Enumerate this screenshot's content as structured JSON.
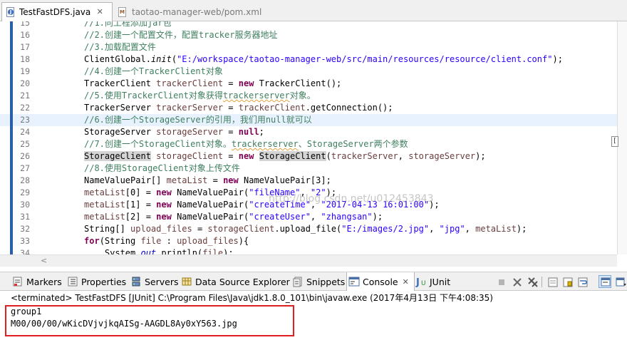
{
  "editor_tabs": [
    {
      "label": "TestFastDFS.java",
      "icon": "java-file-icon",
      "active": true,
      "close": "✕"
    },
    {
      "label": "taotao-manager-web/pom.xml",
      "icon": "xml-file-icon",
      "active": false
    }
  ],
  "code_lines": [
    {
      "n": "15",
      "html": "<span class=\"cmt\">//1.向工程添加jar包</span>"
    },
    {
      "n": "16",
      "html": "<span class=\"cmt\">//2.创建一个配置文件，配置tracker服务器地址</span>"
    },
    {
      "n": "17",
      "html": "<span class=\"cmt\">//3.加载配置文件</span>"
    },
    {
      "n": "18",
      "html": "ClientGlobal.<span class=\"ital\">init</span>(<span class=\"str\">\"E:/workspace/taotao-manager-web/src/main/resources/resource/client.conf\"</span>);"
    },
    {
      "n": "19",
      "html": "<span class=\"cmt\">//4.创建一个TrackerClient对象</span>"
    },
    {
      "n": "20",
      "html": "TrackerClient <span class=\"var\">trackerClient</span> = <span class=\"kw\">new</span> TrackerClient();"
    },
    {
      "n": "21",
      "html": "<span class=\"cmt\">//5.使用TrackerClient对象获得<span class=\"squig\">trackerserver</span>对象。</span>"
    },
    {
      "n": "22",
      "html": "TrackerServer <span class=\"var\">trackerServer</span> = <span class=\"var\">trackerClient</span>.getConnection();"
    },
    {
      "n": "23",
      "html": "<span class=\"cmt\">//6.创建一个StorageServer的引用，我们用null就可以</span>",
      "current": true
    },
    {
      "n": "24",
      "html": "StorageServer <span class=\"var\">storageServer</span> = <span class=\"kw\">null</span>;"
    },
    {
      "n": "25",
      "html": "<span class=\"cmt\">//7.创建一个StorageClient对象。<span class=\"squig\">trackerserver</span>、StorageServer两个参数</span>"
    },
    {
      "n": "26",
      "html": "<span class=\"hl\">StorageClient</span> <span class=\"var\">storageClient</span> = <span class=\"kw\">new</span> <span class=\"hl\">StorageClient</span>(<span class=\"var\">trackerServer</span>, <span class=\"var\">storageServer</span>);"
    },
    {
      "n": "27",
      "html": "<span class=\"cmt\">//8.使用StorageClient对象上传文件</span>"
    },
    {
      "n": "28",
      "html": "NameValuePair[] <span class=\"var\">metaList</span> = <span class=\"kw\">new</span> NameValuePair[3];"
    },
    {
      "n": "29",
      "html": "<span class=\"var\">metaList</span>[0] = <span class=\"kw\">new</span> NameValuePair(<span class=\"str\">\"fileName\"</span>, <span class=\"str\">\"2\"</span>);"
    },
    {
      "n": "30",
      "html": "<span class=\"var\">metaList</span>[1] = <span class=\"kw\">new</span> NameValuePair(<span class=\"str\">\"createTime\"</span>, <span class=\"str\">\"2017-04-13 16:01:00\"</span>);"
    },
    {
      "n": "31",
      "html": "<span class=\"var\">metaList</span>[2] = <span class=\"kw\">new</span> NameValuePair(<span class=\"str\">\"createUser\"</span>, <span class=\"str\">\"zhangsan\"</span>);"
    },
    {
      "n": "32",
      "html": "String[] <span class=\"var\">upload_files</span> = <span class=\"var\">storageClient</span>.upload_file(<span class=\"str\">\"E:/images/2.jpg\"</span>, <span class=\"str\">\"jpg\"</span>, <span class=\"var\">metaList</span>);"
    },
    {
      "n": "33",
      "html": "<span class=\"kw\">for</span>(String <span class=\"var\">file</span> : <span class=\"var\">upload_files</span>){"
    },
    {
      "n": "34",
      "html": "    System.<span class=\"fld\">out</span>.println(<span class=\"var\">file</span>);"
    }
  ],
  "watermark": "http://blog.csdn.net/u012453843",
  "side_marker": "[",
  "view_tabs": [
    {
      "label": "Markers",
      "icon": "markers-icon",
      "active": false
    },
    {
      "label": "Properties",
      "icon": "properties-icon",
      "active": false
    },
    {
      "label": "Servers",
      "icon": "servers-icon",
      "active": false
    },
    {
      "label": "Data Source Explorer",
      "icon": "data-source-explorer-icon",
      "active": false
    },
    {
      "label": "Snippets",
      "icon": "snippets-icon",
      "active": false
    },
    {
      "label": "Console",
      "icon": "console-icon",
      "active": true,
      "close": "✕"
    },
    {
      "label": "JUnit",
      "icon": "junit-icon",
      "active": false
    }
  ],
  "console": {
    "header": "<terminated> TestFastDFS [JUnit] C:\\Program Files\\Java\\jdk1.8.0_101\\bin\\javaw.exe (2017年4月13日 下午4:08:35)",
    "output": [
      "group1",
      "M00/00/00/wKicDVjvjkqAISg-AAGDL8Ay0xY563.jpg"
    ]
  },
  "colors": {
    "comment": "#3f7f5f",
    "keyword": "#7f0055",
    "string": "#2a00ff",
    "highlight_box": "#e02020",
    "ruler": "#2b5ea8"
  }
}
